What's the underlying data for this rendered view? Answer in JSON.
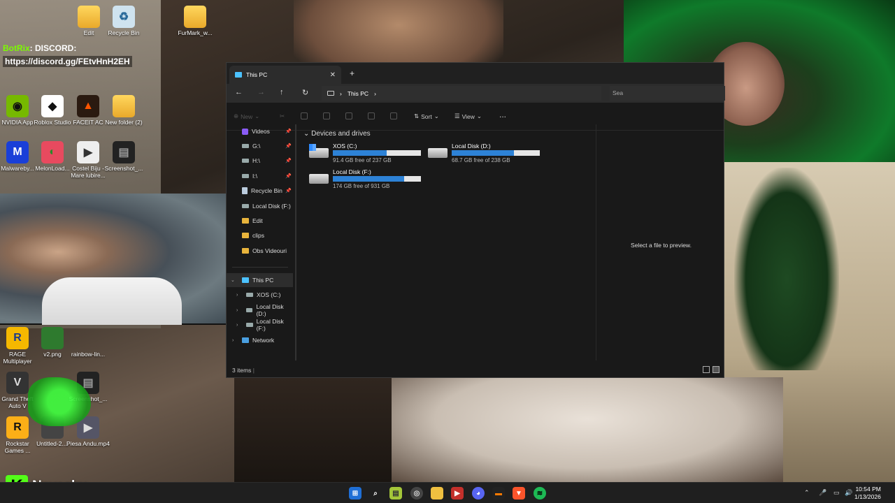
{
  "chat": {
    "user": "BotRix",
    "message": ": DISCORD:",
    "link": "https://discord.gg/FEtvHnH2EH"
  },
  "desktop_icons": [
    {
      "label": "Edit",
      "icon": "folder-icon"
    },
    {
      "label": "Recycle Bin",
      "icon": "recycle-bin-icon"
    },
    {
      "label": "FurMark_w...",
      "icon": "folder-icon"
    },
    {
      "label": "NVIDIA App",
      "icon": "nvidia-icon"
    },
    {
      "label": "Roblox Studio",
      "icon": "roblox-icon"
    },
    {
      "label": "FACEIT AC",
      "icon": "faceit-icon"
    },
    {
      "label": "New folder (2)",
      "icon": "folder-icon"
    },
    {
      "label": "Malwareby...",
      "icon": "malwarebytes-icon"
    },
    {
      "label": "MelonLoad...",
      "icon": "melon-icon"
    },
    {
      "label": "Costel Biju - Mare lubire...",
      "icon": "video-icon"
    },
    {
      "label": "Screenshot_...",
      "icon": "image-icon"
    },
    {
      "label": "RAGE Multiplayer",
      "icon": "rage-icon"
    },
    {
      "label": "v2.png",
      "icon": "image-icon"
    },
    {
      "label": "rainbow-lin...",
      "icon": "image-icon"
    },
    {
      "label": "Grand Theft Auto V",
      "icon": "gta-icon"
    },
    {
      "label": "Screenshot_...",
      "icon": "image-icon"
    },
    {
      "label": "Rockstar Games ...",
      "icon": "rockstar-icon"
    },
    {
      "label": "Untitled-2....",
      "icon": "image-icon"
    },
    {
      "label": "Piesa Andu.mp4",
      "icon": "video-icon"
    }
  ],
  "explorer": {
    "tab_title": "This PC",
    "address": "This PC",
    "search_placeholder": "Sea",
    "toolbar": {
      "new": "New",
      "sort": "Sort",
      "view": "View",
      "more": "..."
    },
    "quick_access": [
      {
        "label": "Videos",
        "icon": "videos-icon",
        "pinned": true
      },
      {
        "label": "G:\\",
        "icon": "drive-icon",
        "pinned": true
      },
      {
        "label": "H:\\",
        "icon": "drive-icon",
        "pinned": true
      },
      {
        "label": "I:\\",
        "icon": "drive-icon",
        "pinned": true
      },
      {
        "label": "Recycle Bin",
        "icon": "recycle-bin-icon",
        "pinned": true
      },
      {
        "label": "Local Disk (F:)",
        "icon": "drive-icon",
        "pinned": false
      },
      {
        "label": "Edit",
        "icon": "folder-icon",
        "pinned": false
      },
      {
        "label": "clips",
        "icon": "folder-icon",
        "pinned": false
      },
      {
        "label": "Obs Videouri",
        "icon": "folder-icon",
        "pinned": false
      }
    ],
    "tree": [
      {
        "label": "This PC",
        "icon": "pc-icon",
        "selected": true
      },
      {
        "label": "XOS (C:)",
        "icon": "windows-drive-icon"
      },
      {
        "label": "Local Disk (D:)",
        "icon": "drive-icon"
      },
      {
        "label": "Local Disk (F:)",
        "icon": "drive-icon"
      },
      {
        "label": "Network",
        "icon": "network-icon"
      }
    ],
    "group_title": "Devices and drives",
    "drives": [
      {
        "name": "XOS (C:)",
        "free": "91.4 GB free of 237 GB",
        "used_fraction": 0.61,
        "icon": "windows-drive-icon"
      },
      {
        "name": "Local Disk (D:)",
        "free": "68.7 GB free of 238 GB",
        "used_fraction": 0.71,
        "icon": "drive-icon"
      },
      {
        "name": "Local Disk (F:)",
        "free": "174 GB free of 931 GB",
        "used_fraction": 0.81,
        "icon": "drive-icon"
      }
    ],
    "preview_text": "Select a file to preview.",
    "status": "3 items"
  },
  "brand": {
    "letter": "K",
    "name": "Navashy"
  },
  "taskbar": {
    "icons": [
      "windows-start-icon",
      "search-icon",
      "notepad-icon",
      "chrome-icon",
      "file-explorer-icon",
      "media-icon",
      "discord-icon",
      "terminal-icon",
      "brave-icon",
      "spotify-icon"
    ],
    "time": "10:54 PM",
    "date": "1/13/2026"
  }
}
